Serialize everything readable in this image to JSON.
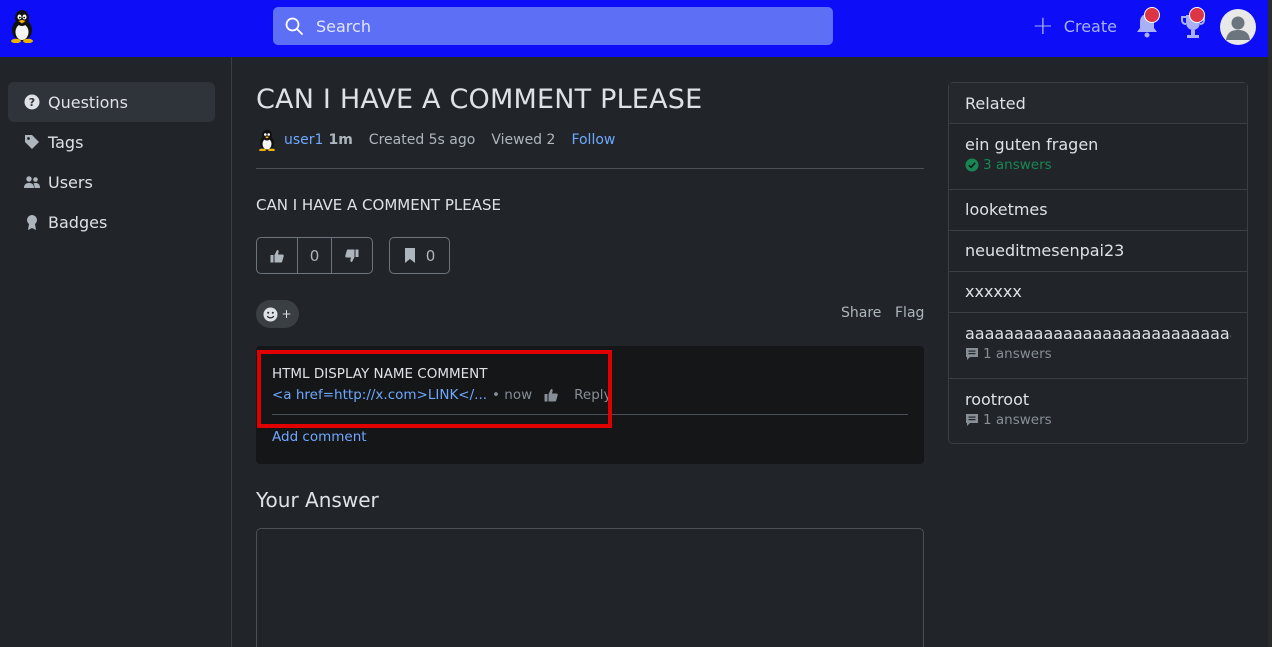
{
  "header": {
    "search_placeholder": "Search",
    "create_label": "Create",
    "brand_color": "#0d0df8"
  },
  "sidebar": {
    "items": [
      {
        "label": "Questions",
        "icon": "question-circle-icon",
        "active": true
      },
      {
        "label": "Tags",
        "icon": "tag-icon"
      },
      {
        "label": "Users",
        "icon": "users-icon"
      },
      {
        "label": "Badges",
        "icon": "award-icon"
      }
    ]
  },
  "question": {
    "title": "CAN I HAVE A COMMENT PLEASE",
    "author": "user1",
    "reputation": "1m",
    "created": "Created 5s ago",
    "viewed": "Viewed 2",
    "follow_label": "Follow",
    "body": "CAN I HAVE A COMMENT PLEASE",
    "votes": "0",
    "bookmarks": "0",
    "share_label": "Share",
    "flag_label": "Flag"
  },
  "comment": {
    "text": "HTML DISPLAY NAME COMMENT",
    "author_display": "<a href=http://x.com>LINK</...",
    "time": "• now",
    "reply_label": "Reply",
    "add_comment_label": "Add comment"
  },
  "answer_section": {
    "heading": "Your Answer"
  },
  "related": {
    "heading": "Related",
    "items": [
      {
        "title": "ein guten fragen",
        "answers": "3 answers",
        "accepted": true
      },
      {
        "title": "looketmes"
      },
      {
        "title": "neueditmesenpai23"
      },
      {
        "title": "xxxxxx"
      },
      {
        "title": "aaaaaaaaaaaaaaaaaaaaaaaaaaaaaa",
        "answers": "1 answers"
      },
      {
        "title": "rootroot",
        "answers": "1 answers"
      }
    ]
  }
}
